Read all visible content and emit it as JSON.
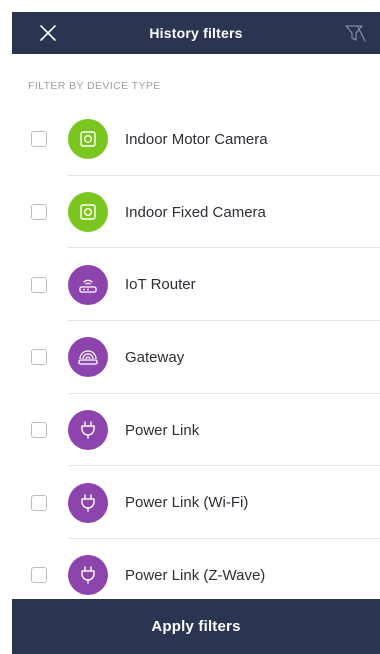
{
  "header": {
    "title": "History filters",
    "close_icon": "close-icon",
    "clear_filter_icon": "filter-clear-icon",
    "background": "#2b3551"
  },
  "section": {
    "label": "FILTER BY DEVICE TYPE"
  },
  "devices": [
    {
      "name": "Indoor Motor Camera",
      "icon": "camera-icon",
      "color": "#7ac51f",
      "checked": false
    },
    {
      "name": "Indoor Fixed Camera",
      "icon": "camera-icon",
      "color": "#7ac51f",
      "checked": false
    },
    {
      "name": "IoT Router",
      "icon": "router-icon",
      "color": "#8e44ad",
      "checked": false
    },
    {
      "name": "Gateway",
      "icon": "gateway-icon",
      "color": "#8e44ad",
      "checked": false
    },
    {
      "name": "Power Link",
      "icon": "plug-icon",
      "color": "#8e44ad",
      "checked": false
    },
    {
      "name": "Power Link (Wi-Fi)",
      "icon": "plug-icon",
      "color": "#8e44ad",
      "checked": false
    },
    {
      "name": "Power Link (Z-Wave)",
      "icon": "plug-icon",
      "color": "#8e44ad",
      "checked": false
    }
  ],
  "footer": {
    "apply_label": "Apply filters"
  }
}
